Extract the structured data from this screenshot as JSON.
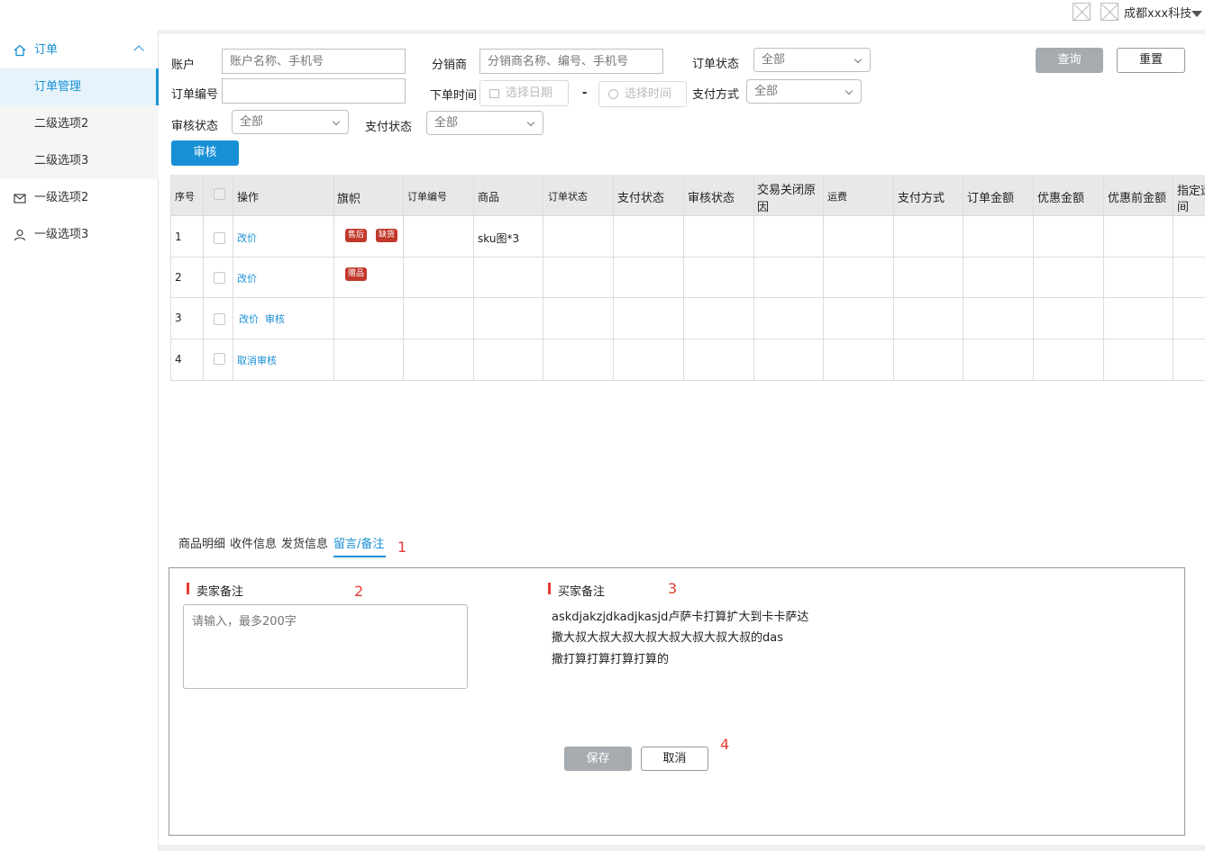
{
  "header": {
    "company": "成都xxx科技"
  },
  "sidebar": {
    "top": "订单",
    "items": [
      "订单管理",
      "二级选项2",
      "二级选项3"
    ],
    "level1": [
      "一级选项2",
      "一级选项3"
    ]
  },
  "filters": {
    "account_label": "账户",
    "account_placeholder": "账户名称、手机号",
    "distributor_label": "分销商",
    "distributor_placeholder": "分销商名称、编号、手机号",
    "order_status_label": "订单状态",
    "order_status_value": "全部",
    "order_no_label": "订单编号",
    "order_no_value": "",
    "order_time_label": "下单时间",
    "date_placeholder": "选择日期",
    "range_sep": "-",
    "time_placeholder": "选择时间",
    "pay_method_label": "支付方式",
    "pay_method_value": "全部",
    "audit_status_label": "审核状态",
    "audit_status_value": "全部",
    "pay_status_label": "支付状态",
    "pay_status_value": "全部",
    "query_btn": "查询",
    "reset_btn": "重置",
    "audit_btn": "审核"
  },
  "table": {
    "headers": [
      "序号",
      "操作",
      "旗帜",
      "订单编号",
      "商品",
      "订单状态",
      "支付状态",
      "审核状态",
      "交易关闭原",
      "因",
      "运费",
      "支付方式",
      "订单金额",
      "优惠金额",
      "优惠前金额",
      "指定运",
      "间"
    ],
    "rows": [
      {
        "no": "1",
        "ops": [
          "改价"
        ],
        "flags": [
          "售后",
          "缺货"
        ],
        "product": "sku图*3"
      },
      {
        "no": "2",
        "ops": [
          "改价"
        ],
        "flags": [
          "赠品"
        ],
        "product": ""
      },
      {
        "no": "3",
        "ops": [
          "改价",
          "审核"
        ],
        "flags": [],
        "product": ""
      },
      {
        "no": "4",
        "ops": [
          "取消审核"
        ],
        "flags": [],
        "product": ""
      }
    ]
  },
  "tabs": [
    "商品明细",
    "收件信息",
    "发货信息",
    "留言/备注"
  ],
  "annotations": [
    "1",
    "2",
    "3",
    "4"
  ],
  "remarks": {
    "seller_title": "卖家备注",
    "seller_placeholder": "请输入，最多200字",
    "buyer_title": "买家备注",
    "buyer_lines": [
      "askdjakzjdkadjkasjd卢萨卡打算扩大到卡卡萨达",
      "撒大叔大叔大叔大叔大叔大叔大叔大叔的das",
      "撒打算打算打算打算的"
    ],
    "save_btn": "保存",
    "cancel_btn": "取消"
  }
}
